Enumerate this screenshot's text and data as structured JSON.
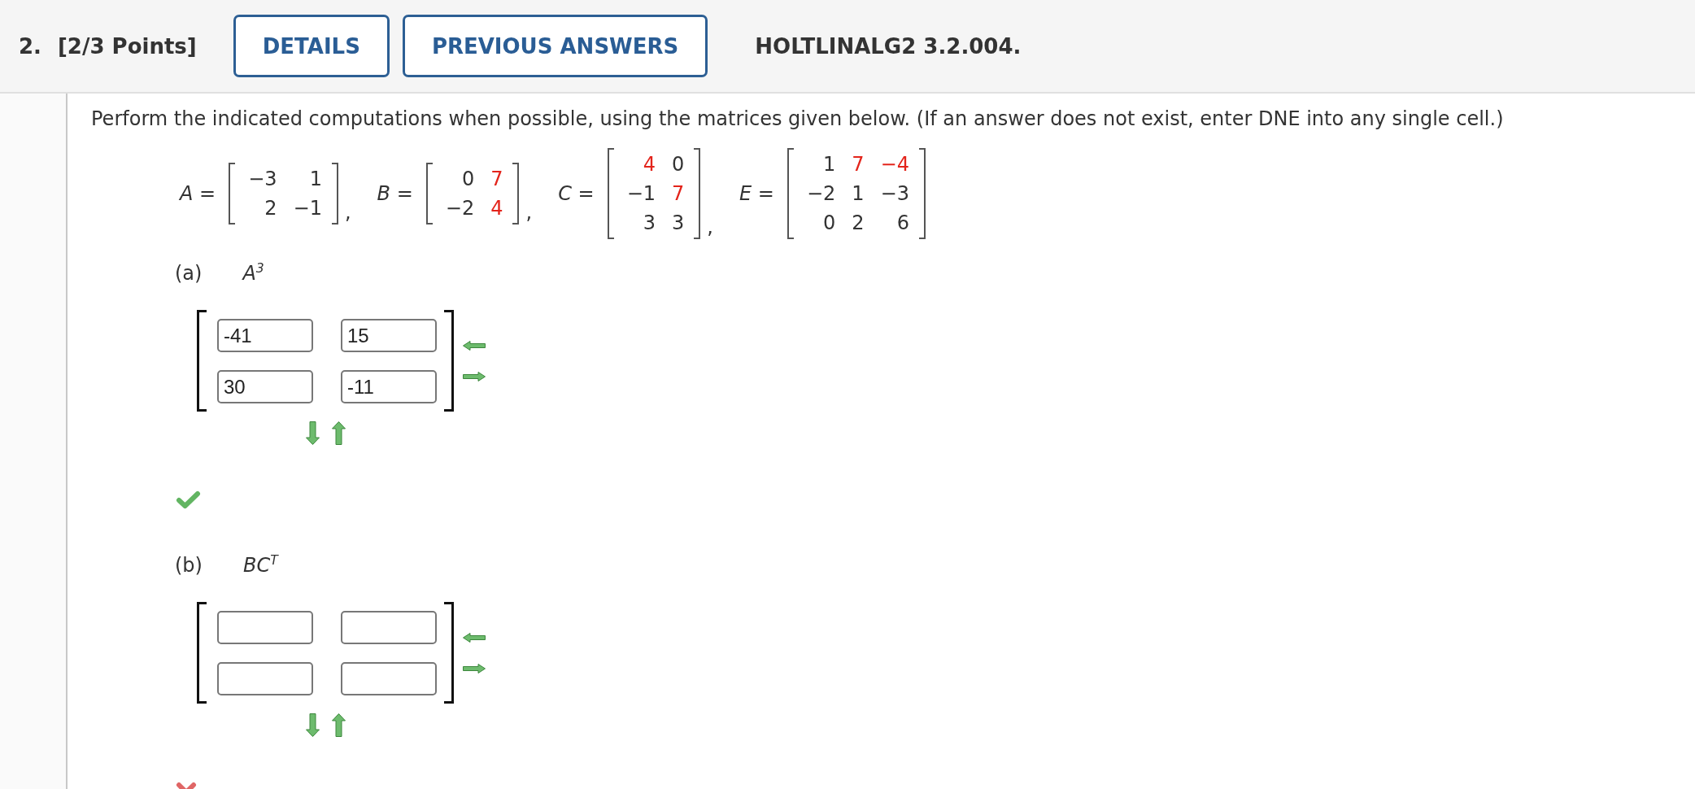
{
  "header": {
    "number": "2.",
    "points": "[2/3 Points]",
    "buttons": [
      "DETAILS",
      "PREVIOUS ANSWERS"
    ],
    "code": "HOLTLINALG2 3.2.004."
  },
  "instructions": "Perform the indicated computations when possible, using the matrices given below. (If an answer does not exist, enter DNE into any single cell.)",
  "matrices": [
    {
      "label": "*A* =",
      "rows": [
        [
          {
            "text": "−3",
            "color": "#333333"
          },
          {
            "text": "1",
            "color": "#333333"
          }
        ],
        [
          {
            "text": "2",
            "color": "#333333"
          },
          {
            "text": "−1",
            "color": "#333333"
          }
        ]
      ],
      "separator": ","
    },
    {
      "label": "*B* =",
      "rows": [
        [
          {
            "text": "0",
            "color": "#333333"
          },
          {
            "text": "7",
            "color": "#e3241b"
          }
        ],
        [
          {
            "text": "−2",
            "color": "#333333"
          },
          {
            "text": "4",
            "color": "#e3241b"
          }
        ]
      ],
      "separator": ","
    },
    {
      "label": "*C* =",
      "rows": [
        [
          {
            "text": "4",
            "color": "#e3241b"
          },
          {
            "text": "0",
            "color": "#333333"
          }
        ],
        [
          {
            "text": "−1",
            "color": "#333333"
          },
          {
            "text": "7",
            "color": "#e3241b"
          }
        ],
        [
          {
            "text": "3",
            "color": "#333333"
          },
          {
            "text": "3",
            "color": "#333333"
          }
        ]
      ],
      "separator": ","
    },
    {
      "label": "*E* =",
      "rows": [
        [
          {
            "text": "1",
            "color": "#333333"
          },
          {
            "text": "7",
            "color": "#e3241b"
          },
          {
            "text": "−4",
            "color": "#e3241b"
          }
        ],
        [
          {
            "text": "−2",
            "color": "#333333"
          },
          {
            "text": "1",
            "color": "#333333"
          },
          {
            "text": "−3",
            "color": "#333333"
          }
        ],
        [
          {
            "text": "0",
            "color": "#333333"
          },
          {
            "text": "2",
            "color": "#333333"
          },
          {
            "text": "6",
            "color": "#333333"
          }
        ]
      ]
    }
  ],
  "parts": [
    {
      "label": "(a)",
      "expression": "A$^{3}$",
      "cells": [
        [
          {
            "value": "-41"
          },
          {
            "value": "15"
          }
        ],
        [
          {
            "value": "30"
          },
          {
            "value": "-11"
          }
        ]
      ],
      "correct": true
    },
    {
      "label": "(b)",
      "expression": "BC$^{T}$",
      "cells": [
        [
          {},
          {}
        ],
        [
          {},
          {}
        ]
      ],
      "correct": false
    }
  ]
}
